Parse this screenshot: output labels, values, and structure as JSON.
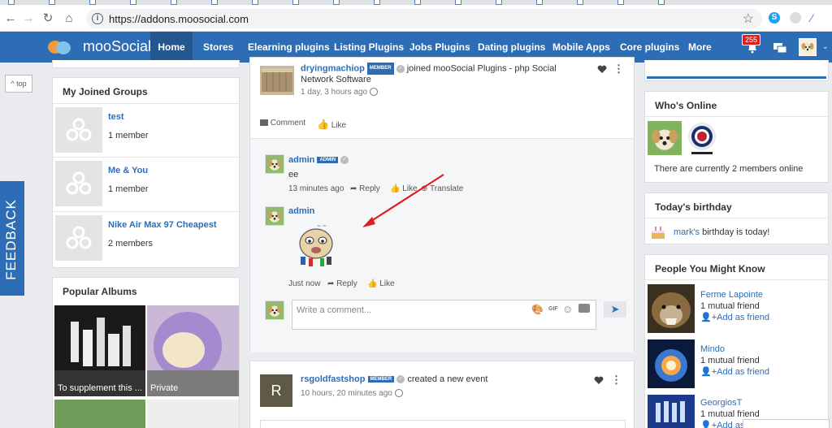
{
  "browser": {
    "url": "https://addons.moosocial.com",
    "back": "←",
    "forward": "→",
    "reload": "↻",
    "home": "⌂",
    "star": "☆"
  },
  "site": {
    "logo": "mooSocial",
    "nav": [
      "Home",
      "Stores",
      "Elearning plugins",
      "Listing Plugins",
      "Jobs Plugins",
      "Dating plugins",
      "Mobile Apps",
      "Core plugins",
      "More"
    ],
    "notification_count": "255"
  },
  "side": {
    "totop": "^ top",
    "feedback": "FEEDBACK"
  },
  "left": {
    "groups_title": "My Joined Groups",
    "groups": [
      {
        "name": "test",
        "meta": "1 member"
      },
      {
        "name": "Me & You",
        "meta": "1 member"
      },
      {
        "name": "Nike Air Max 97 Cheapest",
        "meta": "2 members"
      }
    ],
    "albums_title": "Popular Albums",
    "albums": [
      {
        "caption": "To supplement this ..."
      },
      {
        "caption": "Private"
      }
    ]
  },
  "feed": {
    "post1": {
      "author": "dryingmachiop",
      "badge": "MEMBER",
      "action": "joined mooSocial Plugins - php Social Network Software",
      "time": "1 day, 3 hours ago",
      "comment_label": "Comment",
      "like_label": "Like"
    },
    "comments": [
      {
        "author": "admin",
        "badge": "ADMIN",
        "text": "ee",
        "time": "13 minutes ago",
        "reply": "Reply",
        "like": "Like",
        "translate": "Translate"
      },
      {
        "author": "admin",
        "time": "Just now",
        "reply": "Reply",
        "like": "Like"
      }
    ],
    "composer": {
      "placeholder": "Write a comment...",
      "gif": "GIF"
    },
    "post2": {
      "avatar_letter": "R",
      "author": "rsgoldfastshop",
      "badge": "MEMBER",
      "action": "created a new event",
      "time": "10 hours, 20 minutes ago"
    }
  },
  "right": {
    "online_title": "Who's Online",
    "online_text": "There are currently 2 members online",
    "birthday_title": "Today's birthday",
    "birthday_name": "mark's",
    "birthday_text": " birthday is today!",
    "pymk_title": "People You Might Know",
    "people": [
      {
        "name": "Ferme Lapointe",
        "mutual": "1 mutual friend",
        "add": "Add as friend"
      },
      {
        "name": "Mindo",
        "mutual": "1 mutual friend",
        "add": "Add as friend"
      },
      {
        "name": "GeorgiosT",
        "mutual": "1 mutual friend",
        "add": "Add as"
      }
    ]
  },
  "colors": {
    "brand": "#2d6db5",
    "badge": "#e02020",
    "arrow": "#e01c1c"
  }
}
